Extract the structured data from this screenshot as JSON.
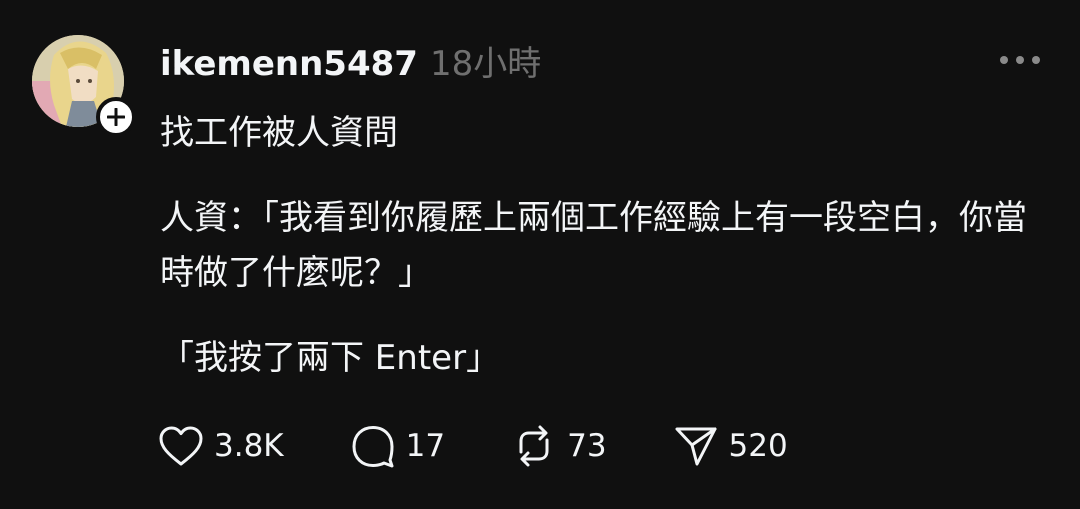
{
  "post": {
    "username": "ikemenn5487",
    "timestamp": "18小時",
    "paragraphs": [
      "找工作被人資問",
      "人資：「我看到你履歷上兩個工作經驗上有一段空白，你當時做了什麼呢？」",
      "「我按了兩下 Enter」"
    ]
  },
  "actions": {
    "likes": "3.8K",
    "comments": "17",
    "reposts": "73",
    "shares": "520"
  },
  "icons": {
    "avatar": "avatar",
    "follow": "plus-icon",
    "more": "more-icon",
    "like": "heart-icon",
    "comment": "comment-icon",
    "repost": "repost-icon",
    "share": "send-icon"
  },
  "colors": {
    "background": "#101010",
    "text": "#f3f5f7",
    "muted": "#6f6f6f"
  }
}
